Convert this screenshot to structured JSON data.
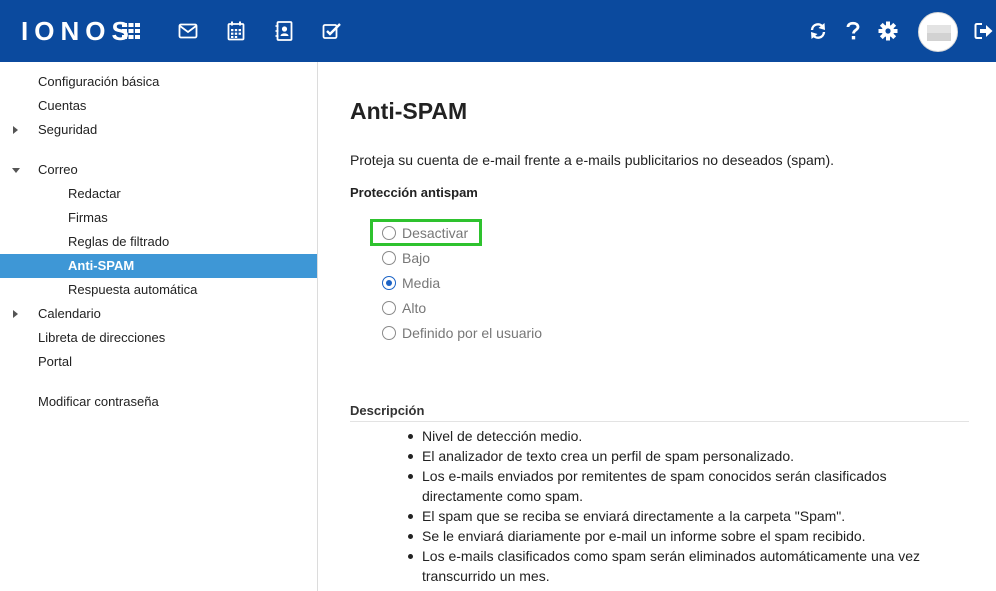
{
  "header": {
    "logo": "IONOS",
    "icons": [
      "apps-grid-icon",
      "mail-icon",
      "calendar-icon",
      "contacts-icon",
      "tasks-icon",
      "refresh-icon",
      "help-icon",
      "settings-icon",
      "avatar",
      "logout-icon"
    ],
    "brand_color": "#0b4a9e"
  },
  "sidebar": {
    "items": [
      {
        "label": "Configuración básica"
      },
      {
        "label": "Cuentas"
      },
      {
        "label": "Seguridad"
      },
      {
        "label": "Correo"
      },
      {
        "label": "Redactar"
      },
      {
        "label": "Firmas"
      },
      {
        "label": "Reglas de filtrado"
      },
      {
        "label": "Anti-SPAM"
      },
      {
        "label": "Respuesta automática"
      },
      {
        "label": "Calendario"
      },
      {
        "label": "Libreta de direcciones"
      },
      {
        "label": "Portal"
      },
      {
        "label": "Modificar contraseña"
      }
    ],
    "active_color": "#3e97d6"
  },
  "main": {
    "title": "Anti-SPAM",
    "intro": "Proteja su cuenta de e-mail frente a e-mails publicitarios no deseados (spam).",
    "protection_title": "Protección antispam",
    "options": [
      {
        "label": "Desactivar",
        "checked": false
      },
      {
        "label": "Bajo",
        "checked": false
      },
      {
        "label": "Media",
        "checked": true
      },
      {
        "label": "Alto",
        "checked": false
      },
      {
        "label": "Definido por el usuario",
        "checked": false
      }
    ],
    "description_title": "Descripción",
    "description": [
      "Nivel de detección medio.",
      "El analizador de texto crea un perfil de spam personalizado.",
      "Los e-mails enviados por remitentes de spam conocidos serán clasificados directamente como spam.",
      "El spam que se reciba se enviará directamente a la carpeta \"Spam\".",
      "Se le enviará diariamente por e-mail un informe sobre el spam recibido.",
      "Los e-mails clasificados como spam serán eliminados automáticamente una vez transcurrido un mes."
    ]
  }
}
